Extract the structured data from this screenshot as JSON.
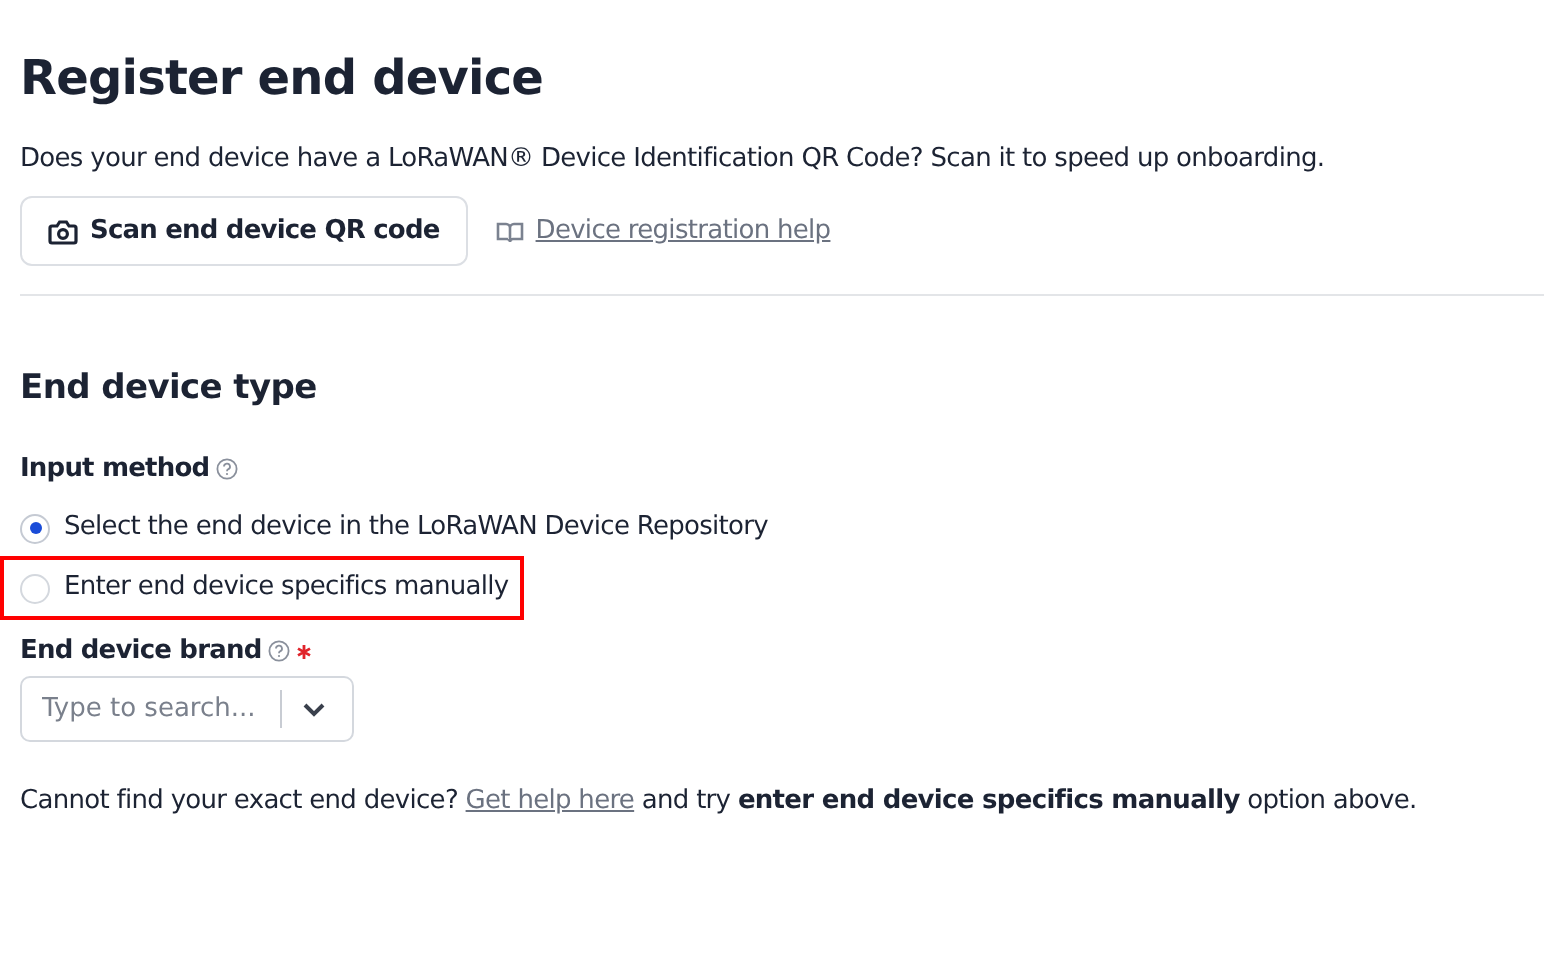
{
  "title": "Register end device",
  "intro": "Does your end device have a LoRaWAN® Device Identification QR Code? Scan it to speed up onboarding.",
  "scan_button": "Scan end device QR code",
  "help_link": "Device registration help",
  "section_title": "End device type",
  "input_method": {
    "label": "Input method",
    "options": [
      {
        "label": "Select the end device in the LoRaWAN Device Repository",
        "selected": true,
        "highlighted": false
      },
      {
        "label": "Enter end device specifics manually",
        "selected": false,
        "highlighted": true
      }
    ]
  },
  "brand": {
    "label": "End device brand",
    "required": true,
    "placeholder": "Type to search..."
  },
  "note": {
    "before": "Cannot find your exact end device?",
    "link": "Get help here",
    "after": "and try **enter end device specifics manually** option above."
  }
}
